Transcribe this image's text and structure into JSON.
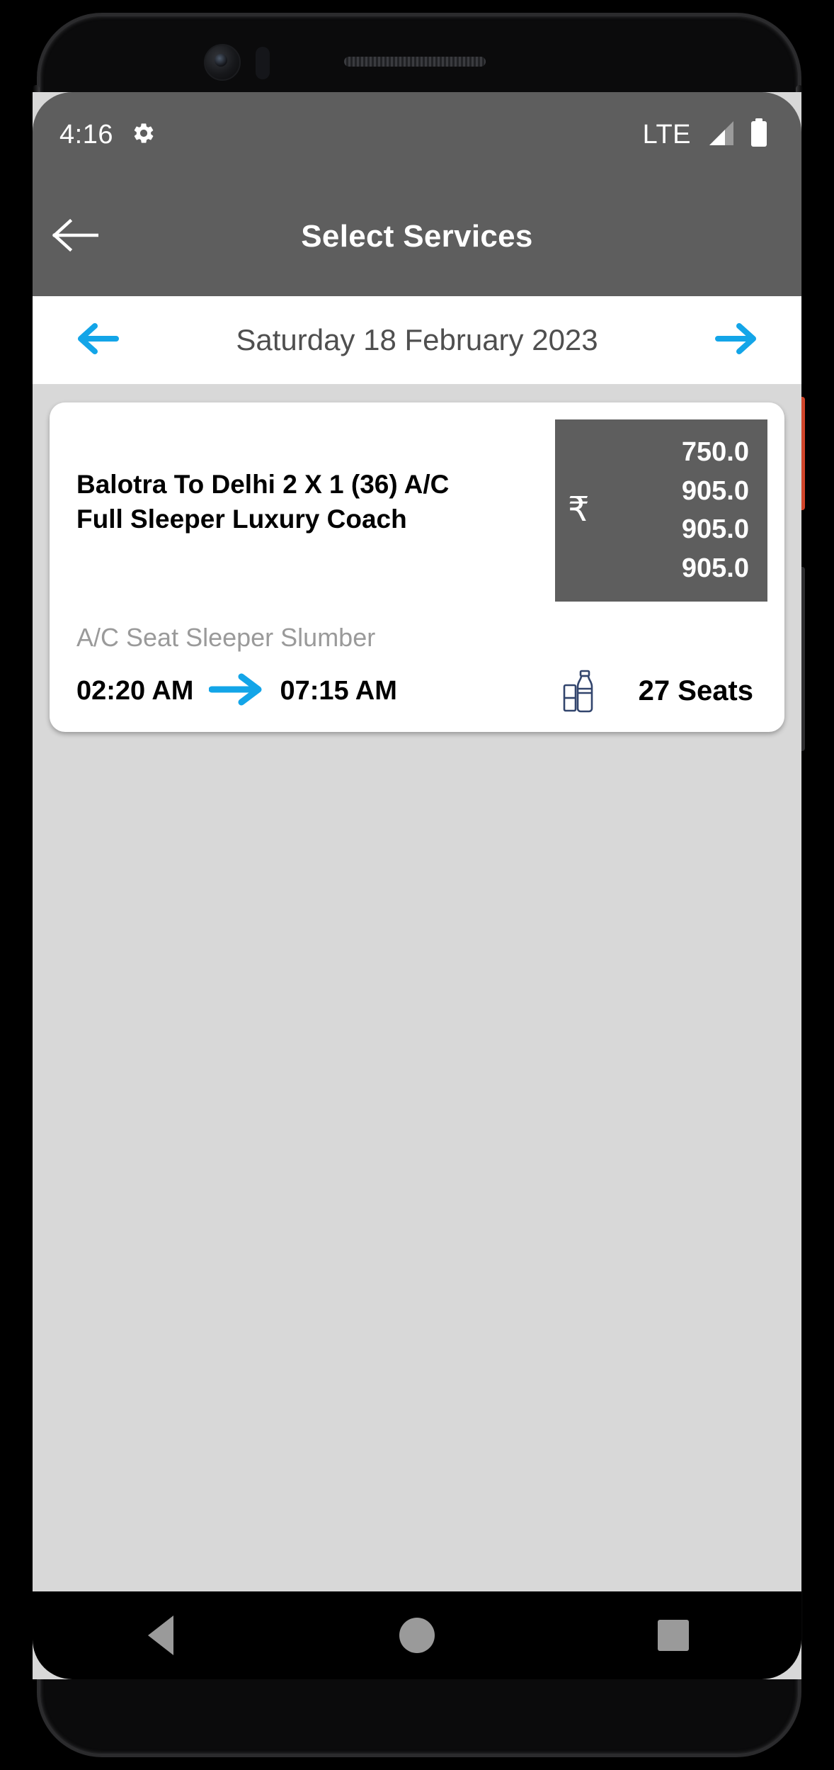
{
  "status_bar": {
    "time": "4:16",
    "gear_icon": "gear-icon",
    "network_label": "LTE",
    "signal_icon": "signal-bars-icon",
    "battery_icon": "battery-full-icon"
  },
  "app_bar": {
    "back_icon": "arrow-left-icon",
    "title": "Select Services"
  },
  "date_selector": {
    "prev_icon": "arrow-left-icon",
    "next_icon": "arrow-right-icon",
    "date_label": "Saturday 18 February 2023"
  },
  "service_card": {
    "title": "Balotra To Delhi 2 X 1 (36) A/C Full Sleeper Luxury Coach",
    "bus_type": "A/C Seat Sleeper Slumber",
    "currency_symbol": "₹",
    "fares": [
      "750.0",
      "905.0",
      "905.0",
      "905.0"
    ],
    "departure_time": "02:20 AM",
    "arrival_time": "07:15 AM",
    "arrow_icon": "arrow-right-icon",
    "amenity_icon": "water-bottle-icon",
    "seats_available": "27 Seats"
  },
  "nav_bar": {
    "back_icon": "triangle-back-icon",
    "home_icon": "circle-home-icon",
    "recents_icon": "square-recents-icon"
  },
  "colors": {
    "app_bar_bg": "#5e5e5e",
    "accent_blue": "#13a5e8",
    "page_bg": "#d8d8d8",
    "card_bg": "#ffffff",
    "fare_box_bg": "#5e5e5e",
    "muted_text": "#9a9a9a",
    "amenity_icon": "#32456d"
  }
}
